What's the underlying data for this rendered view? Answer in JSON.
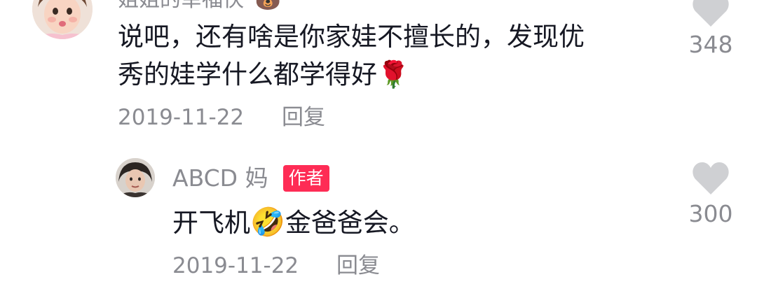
{
  "comment1": {
    "author": "姐姐的幸福快",
    "author_emoji": "🐻",
    "text_line1": "说吧，还有啥是你家娃不擅长的，发现优",
    "text_line2": "秀的娃学什么都学得好",
    "emoji": "🌹",
    "date": "2019-11-22",
    "reply_label": "回复",
    "like_count": "348"
  },
  "comment2": {
    "author": "ABCD 妈",
    "badge": "作者",
    "text_before": "开飞机",
    "emoji": "🤣",
    "text_after": "金爸爸会。",
    "date": "2019-11-22",
    "reply_label": "回复",
    "like_count": "300"
  },
  "colors": {
    "text_primary": "#161823",
    "text_secondary": "#8a8b91",
    "author_badge": "#fe2c55",
    "heart": "#cfd0d3"
  }
}
